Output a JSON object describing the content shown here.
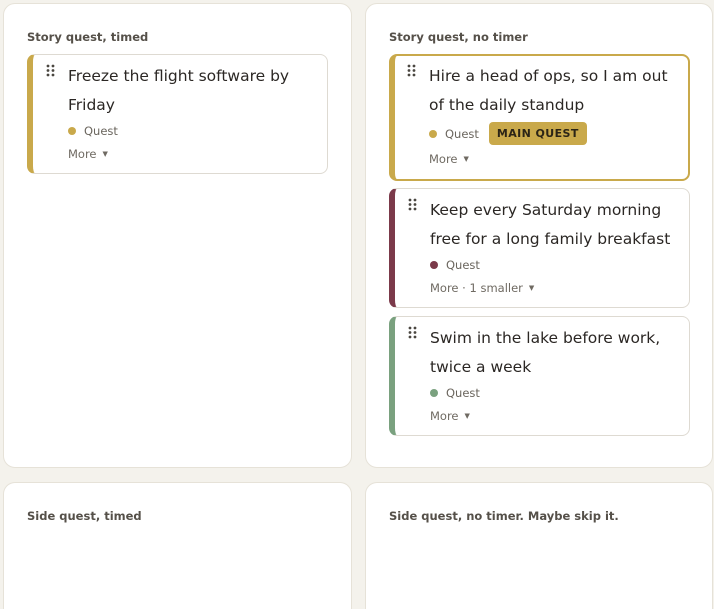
{
  "colors": {
    "gold": "#c9a94b",
    "wine": "#7b3a4a",
    "sage": "#7aa17f"
  },
  "quadrants": [
    {
      "title": "Story quest, timed"
    },
    {
      "title": "Story quest, no timer"
    },
    {
      "title": "Side quest, timed"
    },
    {
      "title": "Side quest, no timer. Maybe skip it."
    }
  ],
  "cards": [
    {
      "title": "Freeze the flight software by Friday",
      "tag": "Quest",
      "more": "More",
      "color": "#c9a94b"
    },
    {
      "title": "Hire a head of ops, so I am out of the daily standup",
      "tag": "Quest",
      "badge": "MAIN QUEST",
      "more": "More",
      "color": "#c9a94b"
    },
    {
      "title": "Keep every Saturday morning free for a long family breakfast",
      "tag": "Quest",
      "more": "More · 1 smaller",
      "color": "#7b3a4a"
    },
    {
      "title": "Swim in the lake before work, twice a week",
      "tag": "Quest",
      "more": "More",
      "color": "#7aa17f"
    }
  ],
  "icons": {
    "drag": "drag-handle-icon",
    "caret": "caret-down-icon"
  }
}
